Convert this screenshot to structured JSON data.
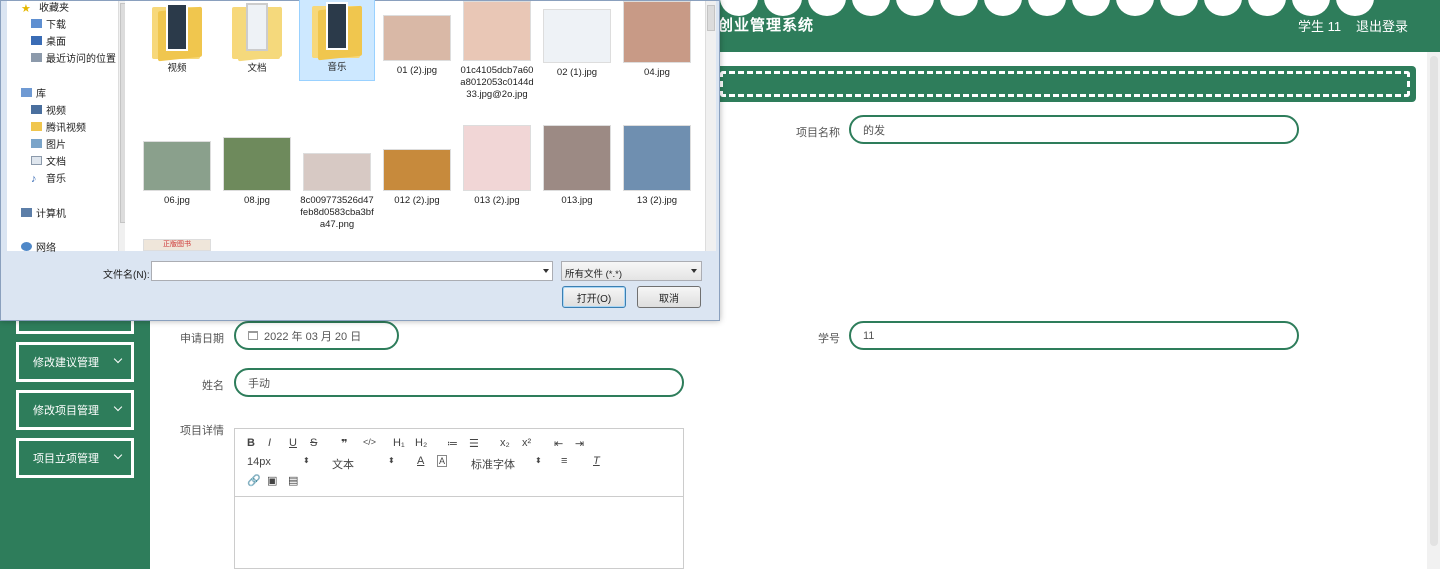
{
  "header": {
    "title": "创业管理系统",
    "user": "学生 11",
    "logout": "退出登录"
  },
  "sidebar": {
    "items": [
      {
        "label": ""
      },
      {
        "label": "修改建议管理"
      },
      {
        "label": "修改项目管理"
      },
      {
        "label": "项目立项管理"
      }
    ]
  },
  "form": {
    "project_name": {
      "label": "项目名称",
      "value": "的发"
    },
    "apply_date": {
      "label": "申请日期",
      "value": "2022 年 03 月 20 日"
    },
    "student_id": {
      "label": "学号",
      "value": "11"
    },
    "name": {
      "label": "姓名",
      "value": "手动"
    },
    "detail": {
      "label": "项目详情"
    }
  },
  "editor": {
    "toolbar": {
      "row1": [
        "B",
        "I",
        "U",
        "S",
        "❞",
        "</>",
        "H₁",
        "H₂",
        "≔",
        "☰",
        "x₂",
        "x²",
        "⇤",
        "⇥"
      ],
      "font_size": "14px",
      "text_type": "文本",
      "font_family": "标准字体"
    }
  },
  "dialog": {
    "nav": {
      "favorites": "收藏夹",
      "downloads": "下载",
      "desktop": "桌面",
      "recent": "最近访问的位置",
      "libraries": "库",
      "videos": "视频",
      "tencent_video": "腾讯视频",
      "pictures": "图片",
      "documents": "文档",
      "music": "音乐",
      "computer": "计算机",
      "network": "网络"
    },
    "files": [
      {
        "name": "视频",
        "kind": "folder"
      },
      {
        "name": "文档",
        "kind": "folder"
      },
      {
        "name": "音乐",
        "kind": "folder"
      },
      {
        "name": "01 (2).jpg",
        "kind": "image",
        "color": "#d9b8a6"
      },
      {
        "name": "01c4105dcb7a60a8012053c0144d33.jpg@2o.jpg",
        "kind": "image",
        "color": "#e9c7b6"
      },
      {
        "name": "02 (1).jpg",
        "kind": "image",
        "color": "#eef2f6"
      },
      {
        "name": "04.jpg",
        "kind": "image",
        "color": "#c89a86"
      },
      {
        "name": "06.jpg",
        "kind": "image",
        "color": "#8aa08c"
      },
      {
        "name": "08.jpg",
        "kind": "image",
        "color": "#6e8a5c"
      },
      {
        "name": "8c009773526d47feb8d0583cba3bfa47.png",
        "kind": "image",
        "color": "#d7c9c4"
      },
      {
        "name": "012 (2).jpg",
        "kind": "image",
        "color": "#c78a3c"
      },
      {
        "name": "013 (2).jpg",
        "kind": "image",
        "color": "#f1d6d6"
      },
      {
        "name": "013.jpg",
        "kind": "image",
        "color": "#9c8a84"
      },
      {
        "name": "13 (2).jpg",
        "kind": "image",
        "color": "#6f8fb0"
      }
    ],
    "partial_thumb_text": "正版图书",
    "filename_label": "文件名(N):",
    "filename_value": "",
    "filetype": "所有文件 (*.*)",
    "open_button": "打开(O)",
    "cancel_button": "取消"
  },
  "colors": {
    "primary_green": "#2e7d5b",
    "dialog_bg": "#dbe5f2"
  }
}
